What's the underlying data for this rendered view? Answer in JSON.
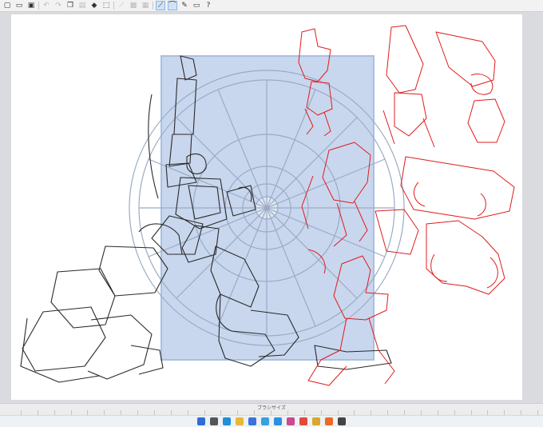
{
  "toolbar": {
    "icons": [
      "new-file",
      "open-folder",
      "save",
      "undo",
      "redo",
      "copy",
      "paste",
      "fill",
      "pen",
      "transform",
      "select",
      "clear",
      "select-all",
      "fill-layer",
      "stroke",
      "ruler-line",
      "ruler-curve",
      "edit",
      "eraser",
      "help"
    ]
  },
  "brush_size_panel": {
    "label": "ブラシサイズ",
    "slot_count": 32
  },
  "taskbar": {
    "apps": [
      "start",
      "search",
      "browser",
      "files",
      "store",
      "photos",
      "mail",
      "paint",
      "media",
      "chrome",
      "clip-studio",
      "tool"
    ]
  },
  "colors": {
    "background": "#d9dbde",
    "canvas": "#ffffff",
    "sketch_black": "#2a2a2a",
    "sketch_red": "#e01b1b",
    "reference_blue": "#c8d7ee"
  }
}
